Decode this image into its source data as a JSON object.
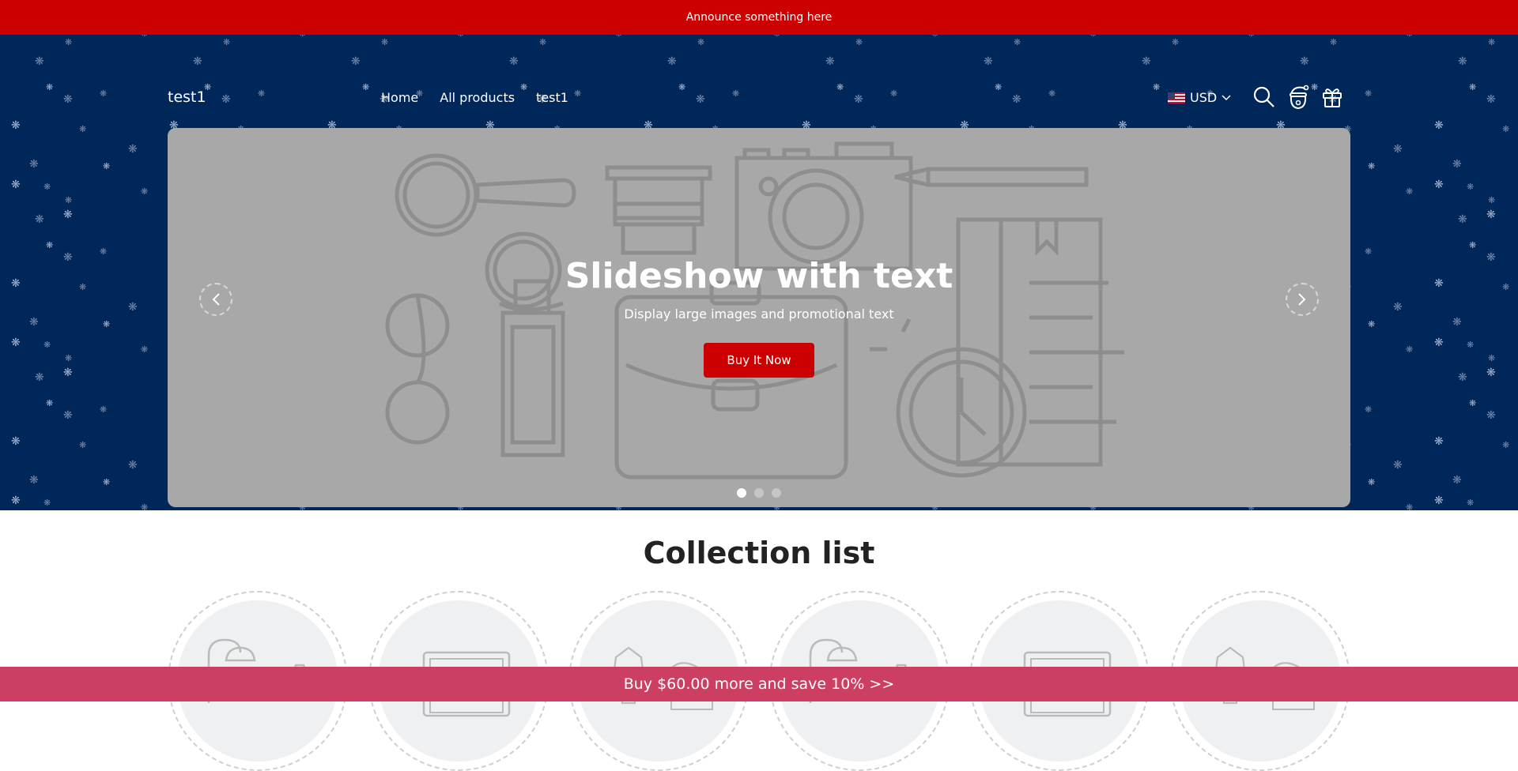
{
  "announcement": {
    "text": "Announce something here",
    "bg_color": "#cc0000"
  },
  "header": {
    "logo": "test1",
    "nav": [
      {
        "label": "Home"
      },
      {
        "label": "All products"
      },
      {
        "label": "test1"
      }
    ],
    "currency": {
      "selected": "USD",
      "flag": "us-flag-icon"
    },
    "icons": [
      "search-icon",
      "santa-account-icon",
      "gift-cart-icon"
    ],
    "bg_color": "#00275a"
  },
  "slideshow": {
    "title": "Slideshow with text",
    "subtitle": "Display large images and promotional text",
    "button_label": "Buy It Now",
    "button_color": "#cc0000",
    "prev_icon": "chevron-left-icon",
    "next_icon": "chevron-right-icon",
    "slides_total": 3,
    "active_slide": 1
  },
  "collection_list": {
    "title": "Collection list",
    "items": [
      {
        "image": "lamps-placeholder"
      },
      {
        "image": "laptop-placeholder"
      },
      {
        "image": "apparel-placeholder"
      },
      {
        "image": "lamps-placeholder"
      },
      {
        "image": "laptop-placeholder"
      },
      {
        "image": "apparel-placeholder"
      }
    ]
  },
  "promo_bar": {
    "text": "Buy $60.00 more and save 10%  >>",
    "bg_color": "#cc3f62"
  }
}
